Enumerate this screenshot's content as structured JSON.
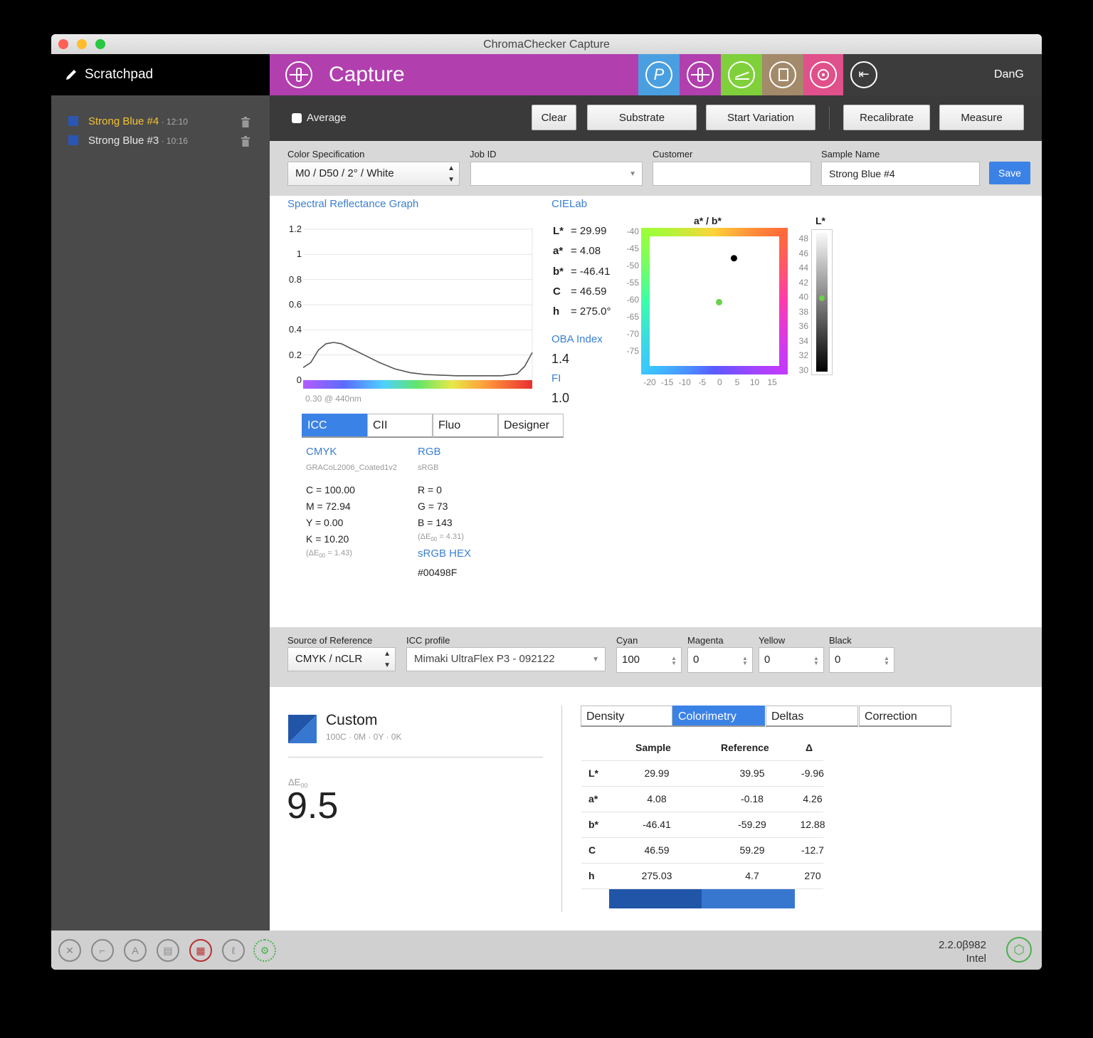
{
  "window": {
    "title": "ChromaChecker Capture"
  },
  "sidebar": {
    "title": "Scratchpad",
    "items": [
      {
        "name": "Strong Blue #4",
        "time": "12:10"
      },
      {
        "name": "Strong Blue #3",
        "time": "10:16"
      }
    ]
  },
  "header": {
    "title": "Capture",
    "user": "DanG"
  },
  "toolbar": {
    "average_label": "Average",
    "clear": "Clear",
    "substrate": "Substrate",
    "start_variation": "Start Variation",
    "recalibrate": "Recalibrate",
    "measure": "Measure"
  },
  "spec": {
    "color_spec_label": "Color Specification",
    "color_spec_value": "M0 / D50 / 2° / White",
    "job_id_label": "Job ID",
    "job_id_value": "",
    "customer_label": "Customer",
    "customer_value": "",
    "sample_name_label": "Sample Name",
    "sample_name_value": "Strong Blue #4",
    "save": "Save"
  },
  "spectral": {
    "title": "Spectral Reflectance Graph",
    "y_ticks": [
      "1.2",
      "1",
      "0.8",
      "0.6",
      "0.4",
      "0.2",
      "0"
    ],
    "readout": "0.30 @ 440nm"
  },
  "chart_data": {
    "type": "line",
    "title": "Spectral Reflectance Graph",
    "xlabel": "",
    "ylabel": "",
    "ylim": [
      0,
      1.2
    ],
    "x": [
      400,
      410,
      420,
      430,
      440,
      450,
      460,
      480,
      500,
      520,
      540,
      560,
      580,
      600,
      620,
      640,
      660,
      680,
      690,
      700
    ],
    "values": [
      0.1,
      0.14,
      0.24,
      0.29,
      0.3,
      0.29,
      0.26,
      0.2,
      0.14,
      0.09,
      0.06,
      0.045,
      0.04,
      0.035,
      0.035,
      0.035,
      0.035,
      0.05,
      0.11,
      0.22
    ]
  },
  "cielab": {
    "title": "CIELab",
    "rows": [
      {
        "k": "L*",
        "v": "= 29.99"
      },
      {
        "k": "a*",
        "v": "= 4.08"
      },
      {
        "k": "b*",
        "v": "= -46.41"
      },
      {
        "k": "C",
        "v": "= 46.59"
      },
      {
        "k": "h",
        "v": "= 275.0°"
      }
    ],
    "oba_title": "OBA Index",
    "oba_value": "1.4",
    "fi_title": "FI",
    "fi_value": "1.0"
  },
  "ab_plot": {
    "title": "a* / b*",
    "y_ticks": [
      "-40",
      "-45",
      "-50",
      "-55",
      "-60",
      "-65",
      "-70",
      "-75"
    ],
    "x_ticks": [
      "-20",
      "-15",
      "-10",
      "-5",
      "0",
      "5",
      "10",
      "15"
    ],
    "xlim": [
      -20,
      17
    ],
    "ylim": [
      -78,
      -40
    ],
    "points": [
      {
        "a": 4.08,
        "b": -46.41,
        "color": "#000000"
      },
      {
        "a": -0.18,
        "b": -59.29,
        "color": "#6ad14a"
      }
    ]
  },
  "l_bar": {
    "title": "L*",
    "ticks": [
      "48",
      "46",
      "44",
      "42",
      "40",
      "38",
      "36",
      "34",
      "32",
      "30"
    ],
    "range": [
      30,
      49
    ],
    "marker": 39.95
  },
  "tabs1": [
    "ICC",
    "CII",
    "Fluo",
    "Designer"
  ],
  "icc": {
    "cmyk_title": "CMYK",
    "cmyk_profile": "GRACoL2006_Coated1v2",
    "cmyk_values": [
      "C = 100.00",
      "M = 72.94",
      "Y = 0.00",
      "K = 10.20"
    ],
    "cmyk_de_prefix": "(ΔE",
    "cmyk_de_sub": "00",
    "cmyk_de_value": " = 1.43)",
    "rgb_title": "RGB",
    "rgb_profile": "sRGB",
    "rgb_values": [
      "R = 0",
      "G = 73",
      "B = 143"
    ],
    "rgb_de_prefix": "(ΔE",
    "rgb_de_sub": "00",
    "rgb_de_value": " = 4.31)",
    "hex_title": "sRGB HEX",
    "hex_value": "#00498F"
  },
  "reference": {
    "source_label": "Source of Reference",
    "source_value": "CMYK / nCLR",
    "icc_label": "ICC profile",
    "icc_value": "Mimaki UltraFlex P3 - 092122",
    "cyan_label": "Cyan",
    "cyan_value": "100",
    "magenta_label": "Magenta",
    "magenta_value": "0",
    "yellow_label": "Yellow",
    "yellow_value": "0",
    "black_label": "Black",
    "black_value": "0"
  },
  "summary": {
    "name": "Custom",
    "subtitle": "100C · 0M · 0Y · 0K",
    "de_label": "ΔE",
    "de_sub": "00",
    "de_value": "9.5",
    "sample_color": "#2155a8",
    "reference_color": "#3777d0"
  },
  "tabs2": [
    "Density",
    "Colorimetry",
    "Deltas",
    "Correction"
  ],
  "colorimetry": {
    "headers": [
      "Sample",
      "Reference",
      "Δ"
    ],
    "rows": [
      {
        "k": "L*",
        "s": "29.99",
        "r": "39.95",
        "d": "-9.96"
      },
      {
        "k": "a*",
        "s": "4.08",
        "r": "-0.18",
        "d": "4.26"
      },
      {
        "k": "b*",
        "s": "-46.41",
        "r": "-59.29",
        "d": "12.88"
      },
      {
        "k": "C",
        "s": "46.59",
        "r": "59.29",
        "d": "-12.7"
      },
      {
        "k": "h",
        "s": "275.03",
        "r": "4.7",
        "d": "270"
      }
    ]
  },
  "status": {
    "version": "2.2.0β982",
    "arch": "Intel"
  },
  "colors": {
    "capture_bar": "#b13fae",
    "icon_blue": "#4a9fe0",
    "icon_magenta": "#b13fae",
    "icon_green": "#7fd03a",
    "icon_tan": "#a38a6a",
    "icon_pink": "#e0508a",
    "accent_blue": "#3b82e6"
  }
}
